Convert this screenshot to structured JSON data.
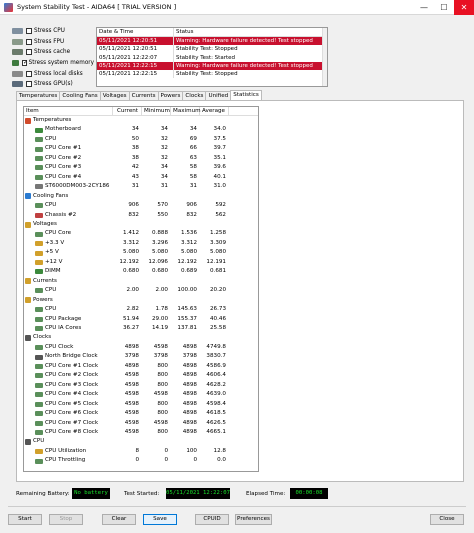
{
  "window": {
    "title": "System Stability Test - AIDA64  [ TRIAL VERSION ]",
    "minimize": "—",
    "maximize": "☐",
    "close": "✕"
  },
  "options": [
    {
      "label": "Stress CPU",
      "checked": false,
      "color": "#7f8f9f"
    },
    {
      "label": "Stress FPU",
      "checked": false,
      "color": "#8a9a8a"
    },
    {
      "label": "Stress cache",
      "checked": false,
      "color": "#6b7b6b"
    },
    {
      "label": "Stress system memory",
      "checked": true,
      "color": "#3e7a3e"
    },
    {
      "label": "Stress local disks",
      "checked": false,
      "color": "#8a8a8a"
    },
    {
      "label": "Stress GPU(s)",
      "checked": false,
      "color": "#5a6a7a"
    }
  ],
  "log": {
    "headers": [
      "Date & Time",
      "Status"
    ],
    "rows": [
      {
        "time": "05/11/2021 12:20:51",
        "status": "Warning: Hardware failure detected! Test stopped",
        "error": true
      },
      {
        "time": "05/11/2021 12:20:51",
        "status": "Stability Test: Stopped",
        "error": false
      },
      {
        "time": "05/11/2021 12:22:07",
        "status": "Stability Test: Started",
        "error": false
      },
      {
        "time": "05/11/2021 12:22:15",
        "status": "Warning: Hardware failure detected! Test stopped",
        "error": true
      },
      {
        "time": "05/11/2021 12:22:15",
        "status": "Stability Test: Stopped",
        "error": false
      }
    ]
  },
  "tabs": [
    "Temperatures",
    "Cooling Fans",
    "Voltages",
    "Currents",
    "Powers",
    "Clocks",
    "Unified",
    "Statistics"
  ],
  "active_tab": 7,
  "stats": {
    "headers": [
      "Item",
      "Current",
      "Minimum",
      "Maximum",
      "Average"
    ],
    "rows": [
      {
        "level": 1,
        "name": "Temperatures",
        "icon": "temperature-icon",
        "color": "#d14b2b"
      },
      {
        "level": 2,
        "name": "Motherboard",
        "icon": "motherboard-icon",
        "color": "#3c8a3c",
        "values": [
          "34",
          "34",
          "34",
          "34.0"
        ]
      },
      {
        "level": 2,
        "name": "CPU",
        "icon": "cpu-icon",
        "color": "#5a8f5a",
        "values": [
          "50",
          "32",
          "69",
          "37.5"
        ]
      },
      {
        "level": 2,
        "name": "CPU Core #1",
        "icon": "cpu-core-icon",
        "color": "#5a8f5a",
        "values": [
          "38",
          "32",
          "66",
          "39.7"
        ]
      },
      {
        "level": 2,
        "name": "CPU Core #2",
        "icon": "cpu-core-icon",
        "color": "#5a8f5a",
        "values": [
          "38",
          "32",
          "63",
          "35.1"
        ]
      },
      {
        "level": 2,
        "name": "CPU Core #3",
        "icon": "cpu-core-icon",
        "color": "#5a8f5a",
        "values": [
          "42",
          "34",
          "58",
          "39.6"
        ]
      },
      {
        "level": 2,
        "name": "CPU Core #4",
        "icon": "cpu-core-icon",
        "color": "#5a8f5a",
        "values": [
          "43",
          "34",
          "58",
          "40.1"
        ]
      },
      {
        "level": 2,
        "name": "ST6000DM003-2CY186",
        "icon": "disk-icon",
        "color": "#777777",
        "values": [
          "31",
          "31",
          "31",
          "31.0"
        ]
      },
      {
        "level": 1,
        "name": "Cooling Fans",
        "icon": "fan-icon",
        "color": "#2b7bd1"
      },
      {
        "level": 2,
        "name": "CPU",
        "icon": "cpu-icon",
        "color": "#5a8f5a",
        "values": [
          "906",
          "570",
          "906",
          "592"
        ]
      },
      {
        "level": 2,
        "name": "Chassis #2",
        "icon": "chassis-icon",
        "color": "#c04040",
        "values": [
          "832",
          "550",
          "832",
          "562"
        ]
      },
      {
        "level": 1,
        "name": "Voltages",
        "icon": "voltage-icon",
        "color": "#d1a02b"
      },
      {
        "level": 2,
        "name": "CPU Core",
        "icon": "cpu-core-icon",
        "color": "#5a8f5a",
        "values": [
          "1.412",
          "0.888",
          "1.536",
          "1.258"
        ]
      },
      {
        "level": 2,
        "name": "+3.3 V",
        "icon": "voltage-icon",
        "color": "#d1a02b",
        "values": [
          "3.312",
          "3.296",
          "3.312",
          "3.309"
        ]
      },
      {
        "level": 2,
        "name": "+5 V",
        "icon": "voltage-icon",
        "color": "#d1a02b",
        "values": [
          "5.080",
          "5.080",
          "5.080",
          "5.080"
        ]
      },
      {
        "level": 2,
        "name": "+12 V",
        "icon": "voltage-icon",
        "color": "#d1a02b",
        "values": [
          "12.192",
          "12.096",
          "12.192",
          "12.191"
        ]
      },
      {
        "level": 2,
        "name": "DIMM",
        "icon": "memory-icon",
        "color": "#3c8a3c",
        "values": [
          "0.680",
          "0.680",
          "0.689",
          "0.681"
        ]
      },
      {
        "level": 1,
        "name": "Currents",
        "icon": "current-icon",
        "color": "#d1a02b"
      },
      {
        "level": 2,
        "name": "CPU",
        "icon": "cpu-icon",
        "color": "#5a8f5a",
        "values": [
          "2.00",
          "2.00",
          "100.00",
          "20.20"
        ]
      },
      {
        "level": 1,
        "name": "Powers",
        "icon": "power-icon",
        "color": "#d1a02b"
      },
      {
        "level": 2,
        "name": "CPU",
        "icon": "cpu-icon",
        "color": "#5a8f5a",
        "values": [
          "2.82",
          "1.78",
          "145.63",
          "26.73"
        ]
      },
      {
        "level": 2,
        "name": "CPU Package",
        "icon": "cpu-icon",
        "color": "#5a8f5a",
        "values": [
          "51.94",
          "29.00",
          "155.37",
          "40.46"
        ]
      },
      {
        "level": 2,
        "name": "CPU IA Cores",
        "icon": "cpu-core-icon",
        "color": "#5a8f5a",
        "values": [
          "36.27",
          "14.19",
          "137.81",
          "25.58"
        ]
      },
      {
        "level": 1,
        "name": "Clocks",
        "icon": "clock-icon",
        "color": "#555555"
      },
      {
        "level": 2,
        "name": "CPU Clock",
        "icon": "cpu-icon",
        "color": "#5a8f5a",
        "values": [
          "4898",
          "4598",
          "4898",
          "4749.8"
        ]
      },
      {
        "level": 2,
        "name": "North Bridge Clock",
        "icon": "chip-icon",
        "color": "#555555",
        "values": [
          "3798",
          "3798",
          "3798",
          "3830.7"
        ]
      },
      {
        "level": 2,
        "name": "CPU Core #1 Clock",
        "icon": "cpu-core-icon",
        "color": "#5a8f5a",
        "values": [
          "4898",
          "800",
          "4898",
          "4586.9"
        ]
      },
      {
        "level": 2,
        "name": "CPU Core #2 Clock",
        "icon": "cpu-core-icon",
        "color": "#5a8f5a",
        "values": [
          "4598",
          "800",
          "4898",
          "4606.4"
        ]
      },
      {
        "level": 2,
        "name": "CPU Core #3 Clock",
        "icon": "cpu-core-icon",
        "color": "#5a8f5a",
        "values": [
          "4598",
          "800",
          "4898",
          "4628.2"
        ]
      },
      {
        "level": 2,
        "name": "CPU Core #4 Clock",
        "icon": "cpu-core-icon",
        "color": "#5a8f5a",
        "values": [
          "4598",
          "4598",
          "4898",
          "4639.0"
        ]
      },
      {
        "level": 2,
        "name": "CPU Core #5 Clock",
        "icon": "cpu-core-icon",
        "color": "#5a8f5a",
        "values": [
          "4598",
          "800",
          "4898",
          "4598.4"
        ]
      },
      {
        "level": 2,
        "name": "CPU Core #6 Clock",
        "icon": "cpu-core-icon",
        "color": "#5a8f5a",
        "values": [
          "4598",
          "800",
          "4898",
          "4618.5"
        ]
      },
      {
        "level": 2,
        "name": "CPU Core #7 Clock",
        "icon": "cpu-core-icon",
        "color": "#5a8f5a",
        "values": [
          "4598",
          "4598",
          "4898",
          "4626.5"
        ]
      },
      {
        "level": 2,
        "name": "CPU Core #8 Clock",
        "icon": "cpu-core-icon",
        "color": "#5a8f5a",
        "values": [
          "4598",
          "800",
          "4898",
          "4665.1"
        ]
      },
      {
        "level": 1,
        "name": "CPU",
        "icon": "cpu-icon",
        "color": "#555555"
      },
      {
        "level": 2,
        "name": "CPU Utilization",
        "icon": "hourglass-icon",
        "color": "#d1a02b",
        "values": [
          "8",
          "0",
          "100",
          "12.8"
        ]
      },
      {
        "level": 2,
        "name": "CPU Throttling",
        "icon": "cpu-icon",
        "color": "#5a8f5a",
        "values": [
          "0",
          "0",
          "0",
          "0.0"
        ]
      }
    ]
  },
  "status": {
    "battery_label": "Remaining Battery:",
    "battery_value": "No battery",
    "started_label": "Test Started:",
    "started_value": "05/11/2021 12:22:07",
    "elapsed_label": "Elapsed Time:",
    "elapsed_value": "00:00:08"
  },
  "buttons": {
    "start": "Start",
    "stop": "Stop",
    "clear": "Clear",
    "save": "Save",
    "cpuid": "CPUID",
    "preferences": "Preferences",
    "close": "Close"
  }
}
